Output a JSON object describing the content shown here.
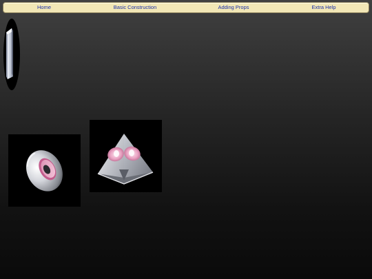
{
  "nav": {
    "home": "Home",
    "basic_construction": "Basic Construction",
    "adding_props": "Adding Props",
    "extra_help": "Extra Help"
  },
  "colors": {
    "nav_background": "#f2e7b6",
    "nav_link": "#1a2ea6",
    "page_background_top": "#404040",
    "page_background_bottom": "#0a0a0a",
    "accent_pink": "#e8a6c6"
  },
  "thumbnails": [
    {
      "name": "torus-shape",
      "icon": "torus-3d-icon"
    },
    {
      "name": "pyramid-shape",
      "icon": "pyramid-3d-icon"
    }
  ],
  "side_handle": {
    "icon": "crystal-prism-icon"
  }
}
